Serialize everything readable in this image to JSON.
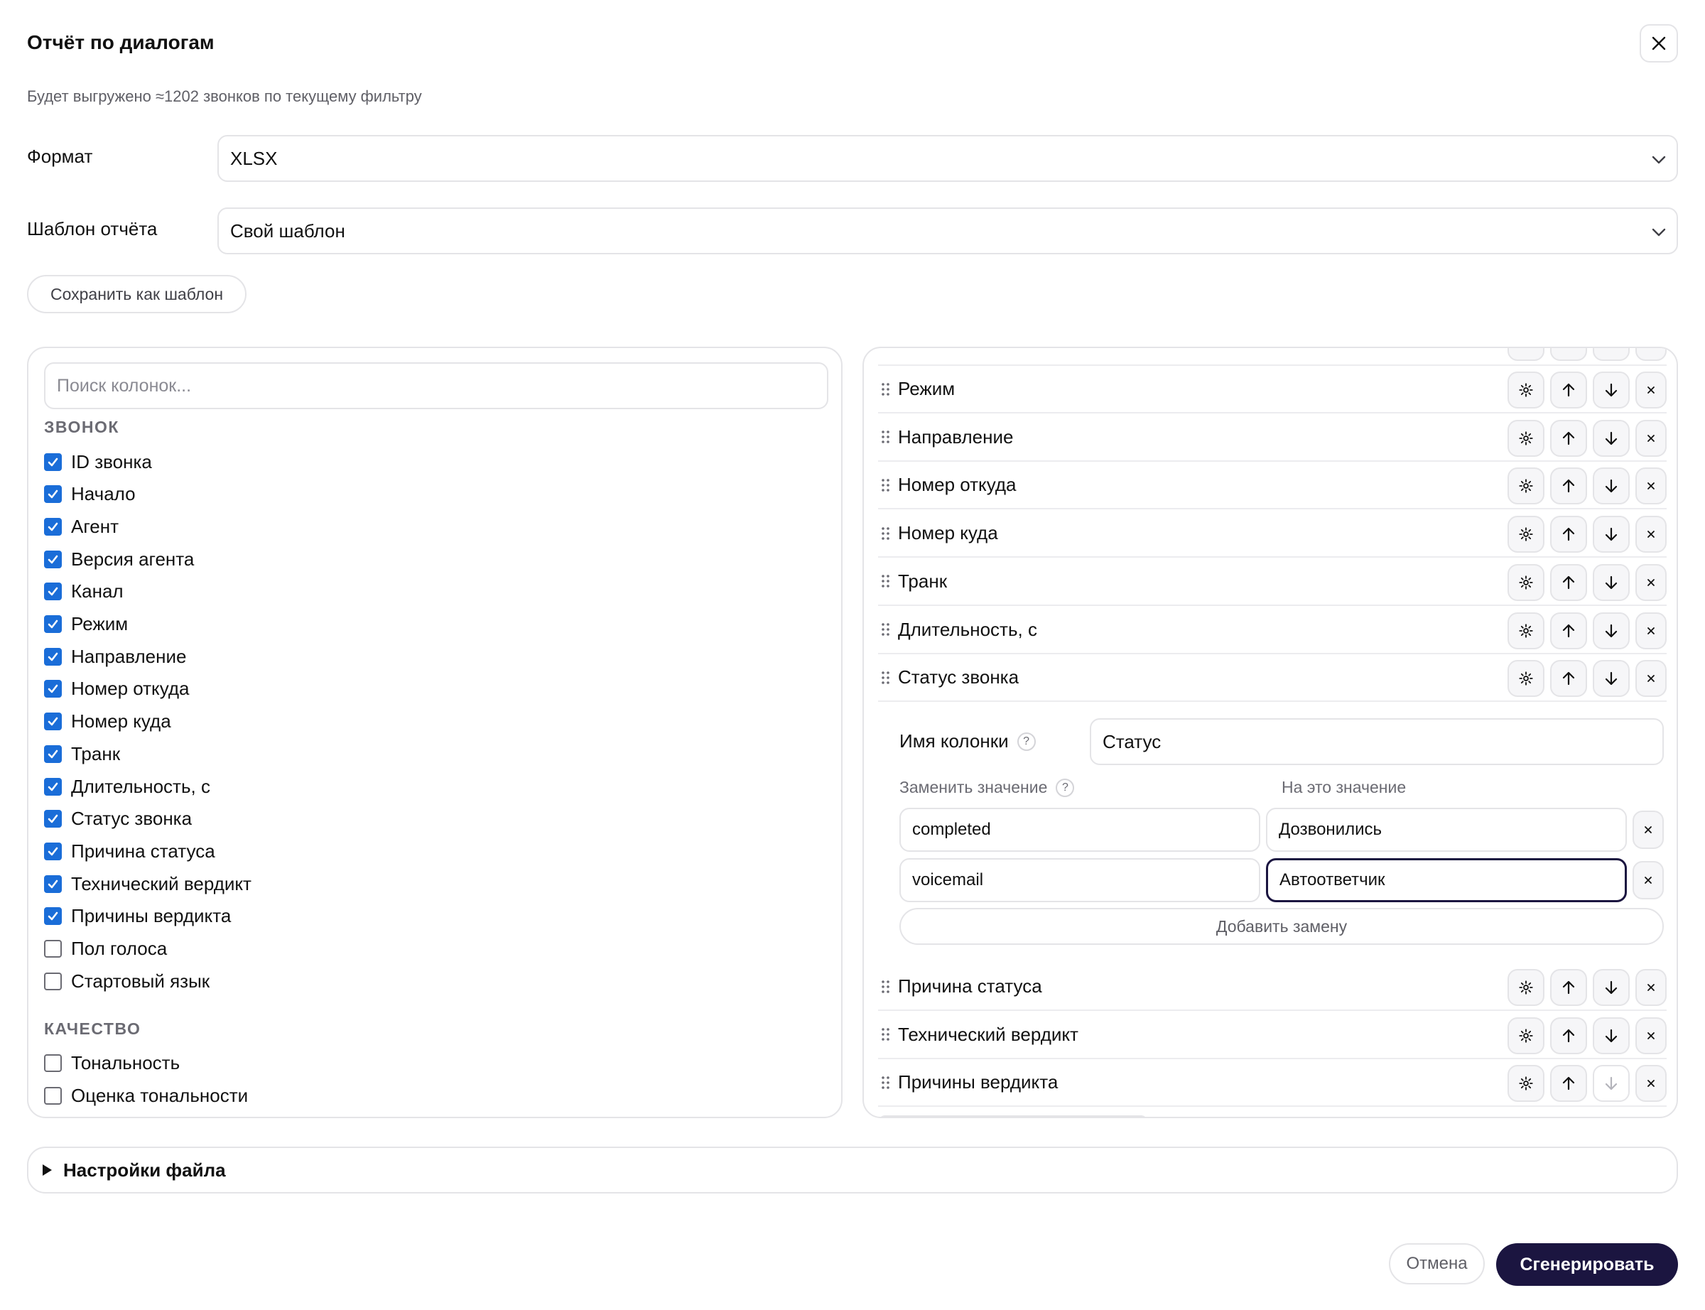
{
  "dialog": {
    "title": "Отчёт по диалогам",
    "subtitle": "Будет выгружено ≈1202 звонков по текущему фильтру"
  },
  "format": {
    "label": "Формат",
    "value": "XLSX"
  },
  "template": {
    "label": "Шаблон отчёта",
    "value": "Свой шаблон"
  },
  "save_template_label": "Сохранить как шаблон",
  "columns_panel": {
    "search_placeholder": "Поиск колонок...",
    "groups": [
      {
        "title": "ЗВОНОК",
        "items": [
          {
            "label": "ID звонка",
            "checked": true
          },
          {
            "label": "Начало",
            "checked": true
          },
          {
            "label": "Агент",
            "checked": true
          },
          {
            "label": "Версия агента",
            "checked": true
          },
          {
            "label": "Канал",
            "checked": true
          },
          {
            "label": "Режим",
            "checked": true
          },
          {
            "label": "Направление",
            "checked": true
          },
          {
            "label": "Номер откуда",
            "checked": true
          },
          {
            "label": "Номер куда",
            "checked": true
          },
          {
            "label": "Транк",
            "checked": true
          },
          {
            "label": "Длительность, с",
            "checked": true
          },
          {
            "label": "Статус звонка",
            "checked": true
          },
          {
            "label": "Причина статуса",
            "checked": true
          },
          {
            "label": "Технический вердикт",
            "checked": true
          },
          {
            "label": "Причины вердикта",
            "checked": true
          },
          {
            "label": "Пол голоса",
            "checked": false
          },
          {
            "label": "Стартовый язык",
            "checked": false
          }
        ]
      },
      {
        "title": "КАЧЕСТВО",
        "items": [
          {
            "label": "Тональность",
            "checked": false
          },
          {
            "label": "Оценка тональности",
            "checked": false
          }
        ]
      }
    ]
  },
  "selected_panel": {
    "rows_top": [
      "Режим",
      "Направление",
      "Номер откуда",
      "Номер куда",
      "Транк",
      "Длительность, с",
      "Статус звонка"
    ],
    "editor": {
      "column_name_label": "Имя колонки",
      "column_name_value": "Статус",
      "replace_label": "Заменить значение",
      "with_label": "На это значение",
      "replacements": [
        {
          "from": "completed",
          "to": "Дозвонились"
        },
        {
          "from": "voicemail",
          "to": "Автоответчик"
        }
      ],
      "add_replacement_label": "Добавить замену"
    },
    "rows_bottom": [
      "Причина статуса",
      "Технический вердикт",
      "Причины вердикта"
    ]
  },
  "file_settings_label": "Настройки файла",
  "footer": {
    "cancel_label": "Отмена",
    "generate_label": "Сгенерировать"
  },
  "colors": {
    "primary": "#1b1540",
    "checkbox": "#1a6dd8",
    "border": "#e4e4e7"
  },
  "icons": {
    "close": "close-icon",
    "chevron": "chevron-down-icon",
    "gear": "gear-icon",
    "up": "arrow-up-icon",
    "down": "arrow-down-icon",
    "remove": "x-icon",
    "drag": "drag-handle-icon"
  }
}
